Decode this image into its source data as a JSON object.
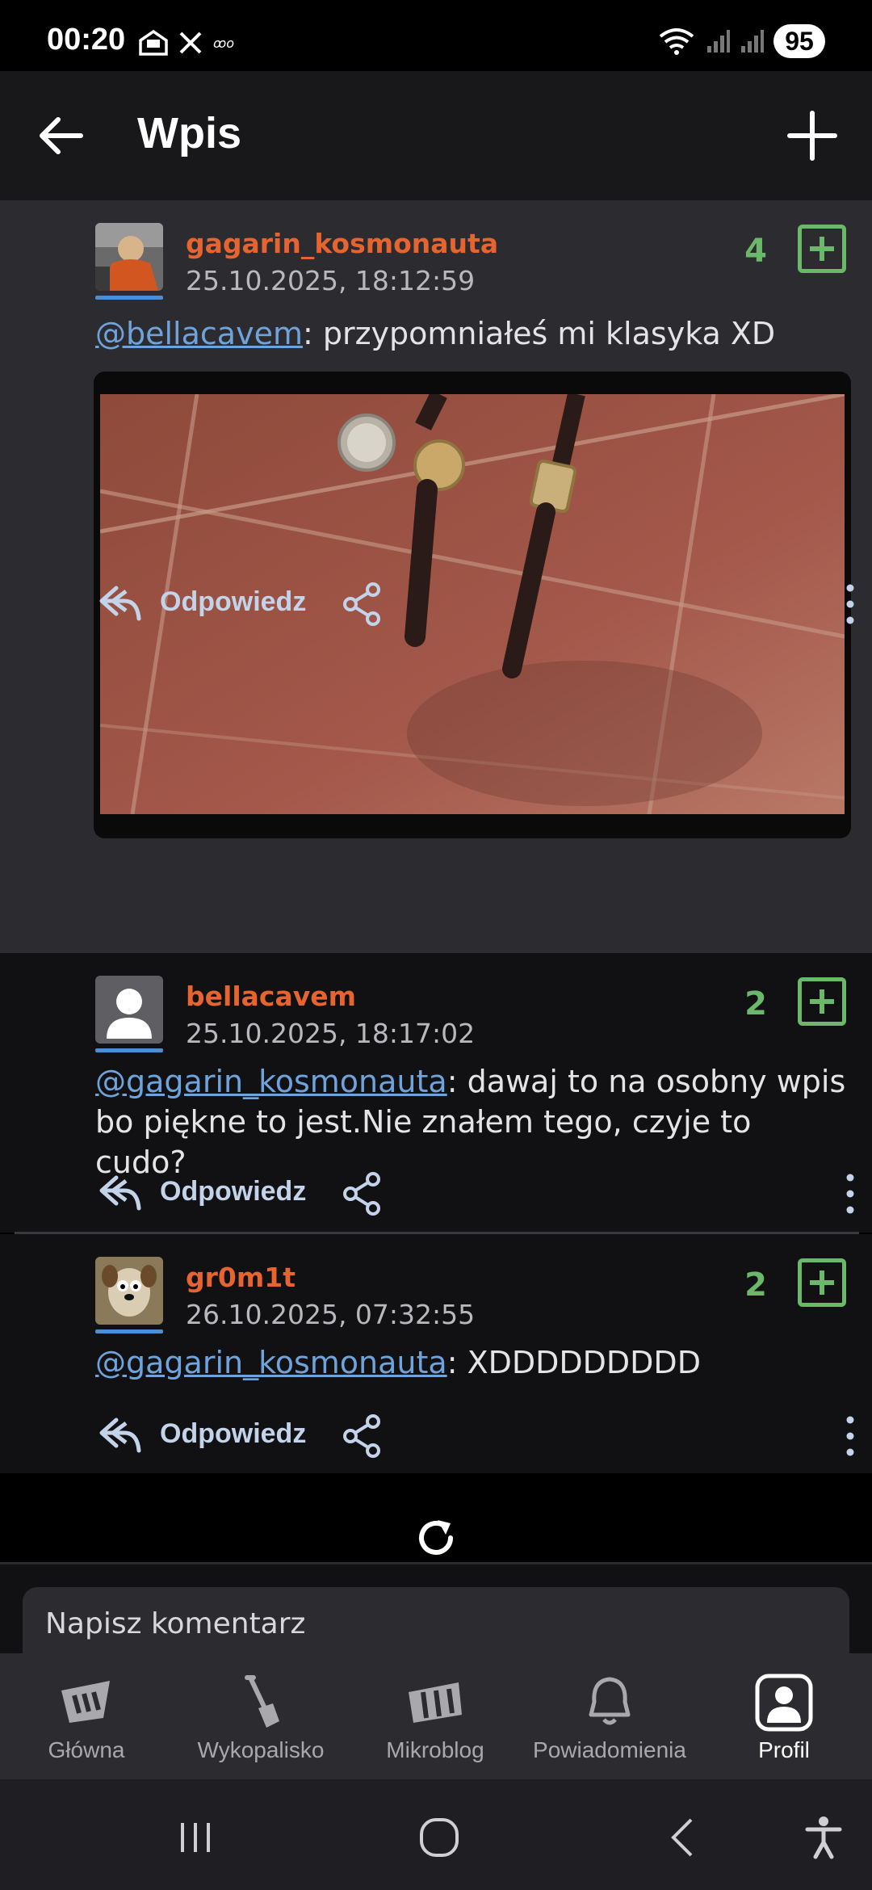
{
  "status_bar": {
    "time": "00:20",
    "battery": "95",
    "icons": [
      "inbox-icon",
      "x-icon",
      "infinity-icon",
      "wifi-icon",
      "signal-icon",
      "signal-icon"
    ]
  },
  "app_bar": {
    "title": "Wpis",
    "back_icon": "arrow-left-icon",
    "add_icon": "plus-icon"
  },
  "comments": [
    {
      "username": "gagarin_kosmonauta",
      "date": "25.10.2025, 18:12:59",
      "score": "4",
      "mention": "@bellacavem",
      "text": ": przypomniałeś mi klasyka XD",
      "has_image": true,
      "reply_label": "Odpowiedz"
    },
    {
      "username": "bellacavem",
      "date": "25.10.2025, 18:17:02",
      "score": "2",
      "mention": "@gagarin_kosmonauta",
      "text": ": dawaj to na osobny wpis bo piękne to jest.Nie znałem tego, czyje to cudo?",
      "has_image": false,
      "reply_label": "Odpowiedz"
    },
    {
      "username": "gr0m1t",
      "date": "26.10.2025, 07:32:55",
      "score": "2",
      "mention": "@gagarin_kosmonauta",
      "text": ": XDDDDDDDDD",
      "has_image": false,
      "reply_label": "Odpowiedz"
    }
  ],
  "comment_input": {
    "placeholder": "Napisz komentarz"
  },
  "bottom_nav": [
    {
      "label": "Główna",
      "icon": "wykop-logo-icon",
      "active": false
    },
    {
      "label": "Wykopalisko",
      "icon": "shovel-icon",
      "active": false
    },
    {
      "label": "Mikroblog",
      "icon": "mikroblog-icon",
      "active": false
    },
    {
      "label": "Powiadomienia",
      "icon": "bell-icon",
      "active": false
    },
    {
      "label": "Profil",
      "icon": "profile-icon",
      "active": true
    }
  ],
  "colors": {
    "username": "#e5642f",
    "score": "#6bb86a",
    "mention": "#6fa3dc",
    "card_highlight": "#2b2b30",
    "card": "#111113"
  }
}
